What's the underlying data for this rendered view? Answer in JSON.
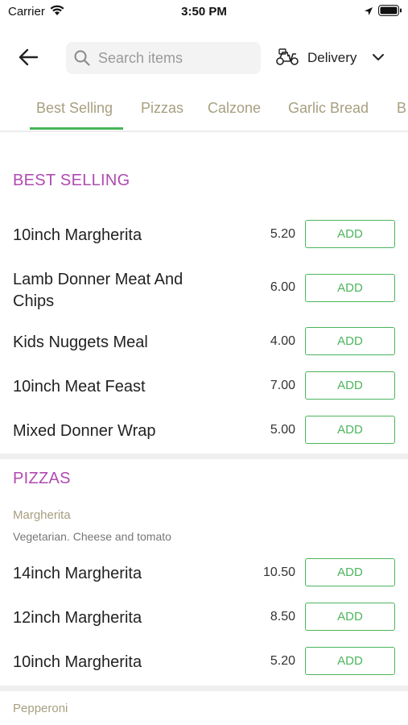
{
  "status": {
    "carrier": "Carrier",
    "time": "3:50 PM"
  },
  "header": {
    "search_placeholder": "Search items",
    "delivery_label": "Delivery"
  },
  "tabs": [
    {
      "label": "Best Selling"
    },
    {
      "label": "Pizzas"
    },
    {
      "label": "Calzone"
    },
    {
      "label": "Garlic Bread"
    },
    {
      "label": "B"
    }
  ],
  "best_selling": {
    "title": "BEST SELLING",
    "items": [
      {
        "name": "10inch Margherita",
        "price": "5.20",
        "button": "ADD"
      },
      {
        "name": "Lamb Donner Meat And Chips",
        "price": "6.00",
        "button": "ADD"
      },
      {
        "name": "Kids Nuggets Meal",
        "price": "4.00",
        "button": "ADD"
      },
      {
        "name": "10inch Meat Feast",
        "price": "7.00",
        "button": "ADD"
      },
      {
        "name": "Mixed Donner Wrap",
        "price": "5.00",
        "button": "ADD"
      }
    ]
  },
  "pizzas": {
    "title": "PIZZAS",
    "group_name": "Margherita",
    "group_desc": "Vegetarian. Cheese and tomato",
    "items": [
      {
        "name": "14inch Margherita",
        "price": "10.50",
        "button": "ADD"
      },
      {
        "name": "12inch Margherita",
        "price": "8.50",
        "button": "ADD"
      },
      {
        "name": "10inch Margherita",
        "price": "5.20",
        "button": "ADD"
      }
    ],
    "next_group_name": "Pepperoni"
  }
}
